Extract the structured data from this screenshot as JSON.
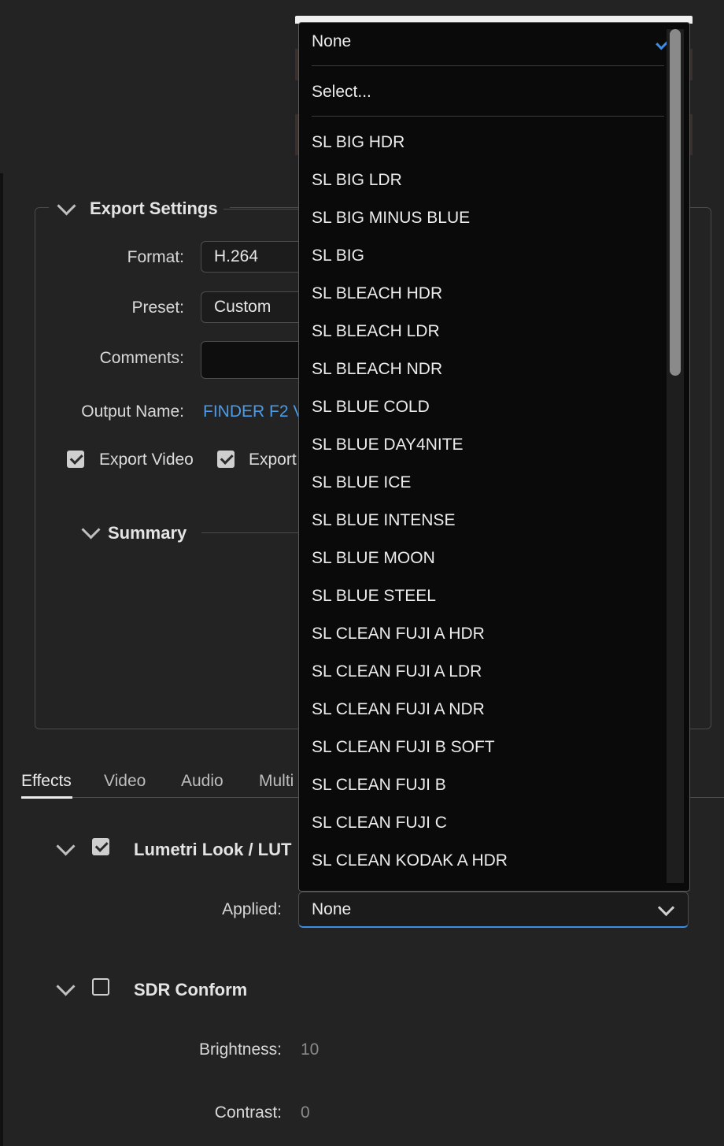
{
  "export_settings": {
    "title": "Export Settings",
    "format_label": "Format:",
    "format_value": "H.264",
    "preset_label": "Preset:",
    "preset_value": "Custom",
    "comments_label": "Comments:",
    "comments_value": "",
    "output_name_label": "Output Name:",
    "output_name_value": "FINDER F2 V",
    "export_video_label": "Export Video",
    "export_video_checked": true,
    "export_audio_label": "Export",
    "export_audio_checked": true
  },
  "summary": {
    "title": "Summary"
  },
  "tabs": [
    {
      "label": "Effects",
      "active": true
    },
    {
      "label": "Video",
      "active": false
    },
    {
      "label": "Audio",
      "active": false
    },
    {
      "label": "Multi",
      "active": false
    }
  ],
  "lumetri": {
    "title": "Lumetri Look / LUT",
    "enabled": true,
    "applied_label": "Applied:",
    "applied_value": "None"
  },
  "sdr_conform": {
    "title": "SDR Conform",
    "enabled": false,
    "brightness_label": "Brightness:",
    "brightness_value": "10",
    "contrast_label": "Contrast:",
    "contrast_value": "0"
  },
  "lut_dropdown": {
    "selected": "None",
    "select_item": "Select...",
    "options": [
      "SL BIG HDR",
      "SL BIG LDR",
      "SL BIG MINUS BLUE",
      "SL BIG",
      "SL BLEACH HDR",
      "SL BLEACH LDR",
      "SL BLEACH NDR",
      "SL BLUE COLD",
      "SL BLUE DAY4NITE",
      "SL BLUE ICE",
      "SL BLUE INTENSE",
      "SL BLUE MOON",
      "SL BLUE STEEL",
      "SL CLEAN FUJI A HDR",
      "SL CLEAN FUJI A LDR",
      "SL CLEAN FUJI A NDR",
      "SL CLEAN FUJI B SOFT",
      "SL CLEAN FUJI B",
      "SL CLEAN FUJI C",
      "SL CLEAN KODAK A HDR"
    ]
  },
  "colors": {
    "background": "#232323",
    "accent": "#3b8ee6",
    "link": "#4a9be8"
  }
}
